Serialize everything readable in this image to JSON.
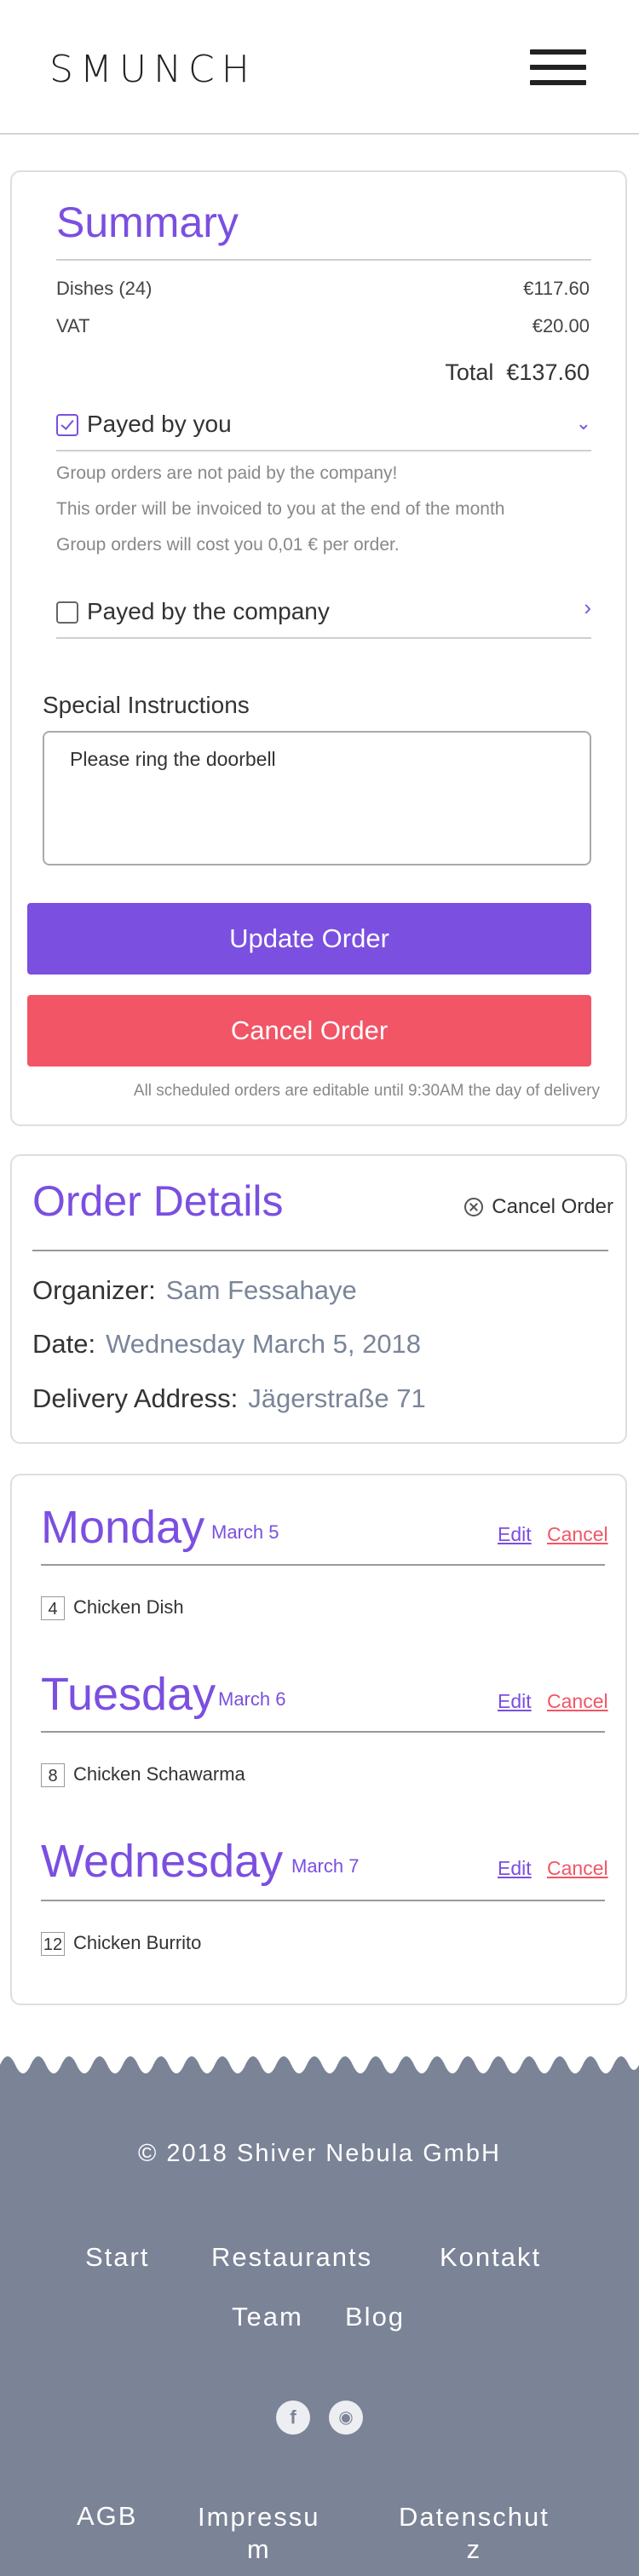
{
  "header": {
    "logo": "SMUNCH",
    "menu_icon": "hamburger-menu-icon"
  },
  "summary": {
    "title": "Summary",
    "dishes_label": "Dishes (24)",
    "dishes_value": "€117.60",
    "vat_label": "VAT",
    "vat_value": "€20.00",
    "total_label": "Total",
    "total_value": "€137.60",
    "payed_by_you": {
      "label": "Payed by you",
      "checked": true
    },
    "notes": [
      "Group orders are not paid by the company!",
      "This order will be invoiced to you at the end of the month",
      "Group orders will cost you 0,01 € per order."
    ],
    "payed_by_company": {
      "label": "Payed by the company",
      "checked": false
    },
    "special_instructions_label": "Special Instructions",
    "special_instructions_value": "Please ring the doorbell",
    "update_button": "Update Order",
    "cancel_button": "Cancel Order",
    "fine_print": "All scheduled orders are editable until 9:30AM the day of delivery"
  },
  "order_details": {
    "title": "Order Details",
    "cancel_link": "Cancel Order",
    "organizer_label": "Organizer:",
    "organizer_value": "Sam Fessahaye",
    "date_label": "Date:",
    "date_value": "Wednesday March 5, 2018",
    "address_label": "Delivery Address:",
    "address_value": "Jägerstraße 71"
  },
  "days": [
    {
      "name": "Monday",
      "date": "March 5",
      "edit": "Edit",
      "cancel": "Cancel",
      "qty": "4",
      "dish": "Chicken Dish"
    },
    {
      "name": "Tuesday",
      "date": "March 6",
      "edit": "Edit",
      "cancel": "Cancel",
      "qty": "8",
      "dish": "Chicken Schawarma"
    },
    {
      "name": "Wednesday",
      "date": "March 7",
      "edit": "Edit",
      "cancel": "Cancel",
      "qty": "12",
      "dish": "Chicken Burrito"
    }
  ],
  "footer": {
    "copyright": "© 2018 Shiver Nebula GmbH",
    "links": [
      "Start",
      "Restaurants",
      "Kontakt",
      "Team",
      "Blog"
    ],
    "social": [
      "facebook-icon",
      "instagram-icon"
    ],
    "legal": [
      "AGB",
      "Impressu m",
      "Datenschut z"
    ],
    "legal_lines": [
      [
        "Impressu",
        "m"
      ],
      [
        "Datenschut",
        "z"
      ]
    ]
  },
  "colors": {
    "accent": "#7b4fe0",
    "danger": "#f25566",
    "footer_bg": "#7b8396"
  }
}
